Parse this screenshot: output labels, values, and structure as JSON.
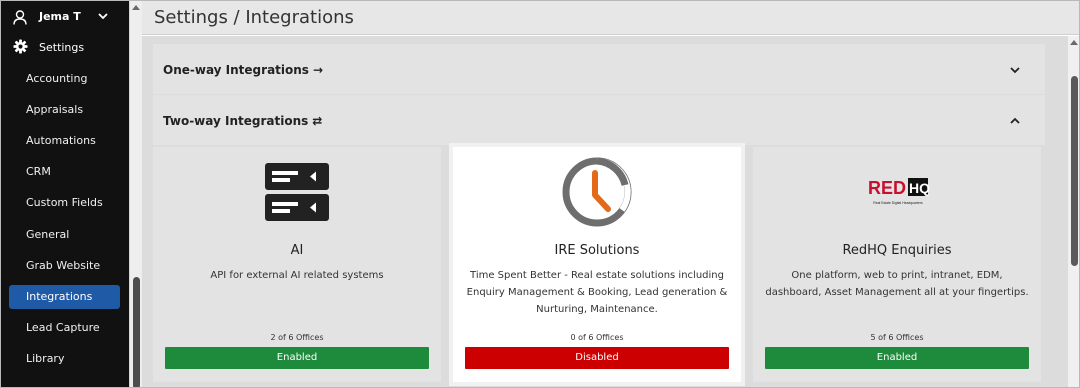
{
  "user": {
    "name": "Jema T",
    "icon": "user-icon",
    "menu_icon": "chevron-down-icon"
  },
  "sidebar": {
    "section_label": "Settings",
    "section_icon": "gear-icon",
    "items": [
      {
        "label": "Accounting"
      },
      {
        "label": "Appraisals"
      },
      {
        "label": "Automations"
      },
      {
        "label": "CRM"
      },
      {
        "label": "Custom Fields"
      },
      {
        "label": "General"
      },
      {
        "label": "Grab Website"
      },
      {
        "label": "Integrations",
        "active": true
      },
      {
        "label": "Lead Capture"
      },
      {
        "label": "Library"
      }
    ]
  },
  "header": {
    "title": "Settings / Integrations"
  },
  "sections": {
    "oneway": {
      "title": "One-way Integrations",
      "arrow": "→",
      "expanded": false
    },
    "twoway": {
      "title": "Two-way Integrations",
      "arrow": "⇄",
      "expanded": true
    }
  },
  "cards": [
    {
      "name": "AI",
      "description": "API for external AI related systems",
      "count": "2 of 6 Offices",
      "status": "Enabled",
      "status_color": "#1e8a3c",
      "icon": "server-icon"
    },
    {
      "name": "IRE Solutions",
      "description": "Time Spent Better - Real estate solutions including Enquiry Management & Booking, Lead generation & Nurturing, Maintenance.",
      "count": "0 of 6 Offices",
      "status": "Disabled",
      "status_color": "#cc0000",
      "icon": "clock-icon"
    },
    {
      "name": "RedHQ Enquiries",
      "description": "One platform, web to print, intranet, EDM, dashboard, Asset Management all at your fingertips.",
      "count": "5 of 6 Offices",
      "status": "Enabled",
      "status_color": "#1e8a3c",
      "icon": "redhq-logo"
    }
  ],
  "redhq_logo": {
    "red_text": "RED",
    "hq_text": "HQ",
    "tagline": "Real Estate Digital Headquarters"
  },
  "colors": {
    "sidebar_bg": "#111111",
    "active_item": "#1f5aa6",
    "enabled": "#1e8a3c",
    "disabled": "#cc0000",
    "clock_accent": "#e26a1a"
  }
}
